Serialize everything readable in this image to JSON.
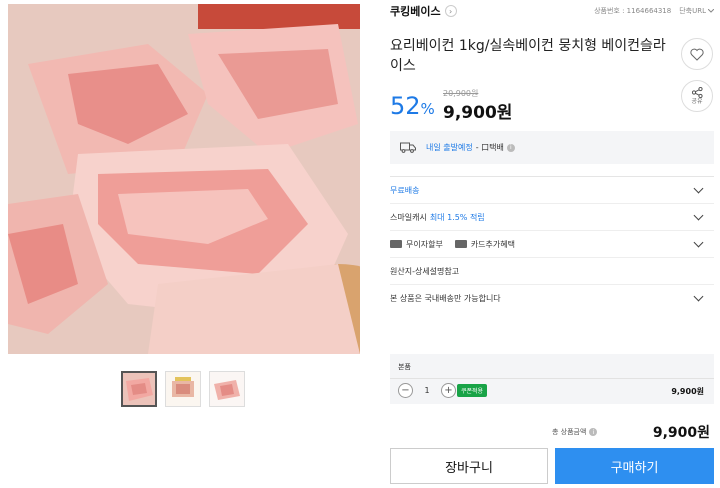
{
  "store": {
    "name": "쿠킹베이스",
    "arrow": "›",
    "product_no": "상품번호 : 1164664318",
    "url_label": "단축URL"
  },
  "product": {
    "title": "요리베이컨 1kg/실속베이컨 뭉치형 베이컨슬라이스",
    "discount_rate": "52",
    "discount_unit": "%",
    "original_price": "20,900원",
    "sale_price": "9,900원"
  },
  "actions": {
    "share_label": "공유"
  },
  "delivery": {
    "label": "내일 출발예정",
    "method": "- 口택배"
  },
  "rows": [
    {
      "text": "무료배송"
    },
    {
      "prefix": "스마일캐시 ",
      "highlight": "최대 1.5% 적립"
    },
    {
      "part1": "무이자할부",
      "part2": "카드추가혜택"
    },
    {
      "text": "원산지-상세설명참고"
    },
    {
      "text": "본 상품은 국내배송만 가능합니다"
    }
  ],
  "option": {
    "name": "본품",
    "quantity": "1",
    "minus": "−",
    "plus": "+",
    "coupon": "쿠폰적용",
    "price": "9,900원"
  },
  "total": {
    "label": "총 상품금액",
    "value": "9,900원"
  },
  "buttons": {
    "cart": "장바구니",
    "buy": "구매하기"
  },
  "colors": {
    "accent": "#1e7ae6",
    "buy_button": "#2e8ff0",
    "coupon": "#19a347"
  }
}
